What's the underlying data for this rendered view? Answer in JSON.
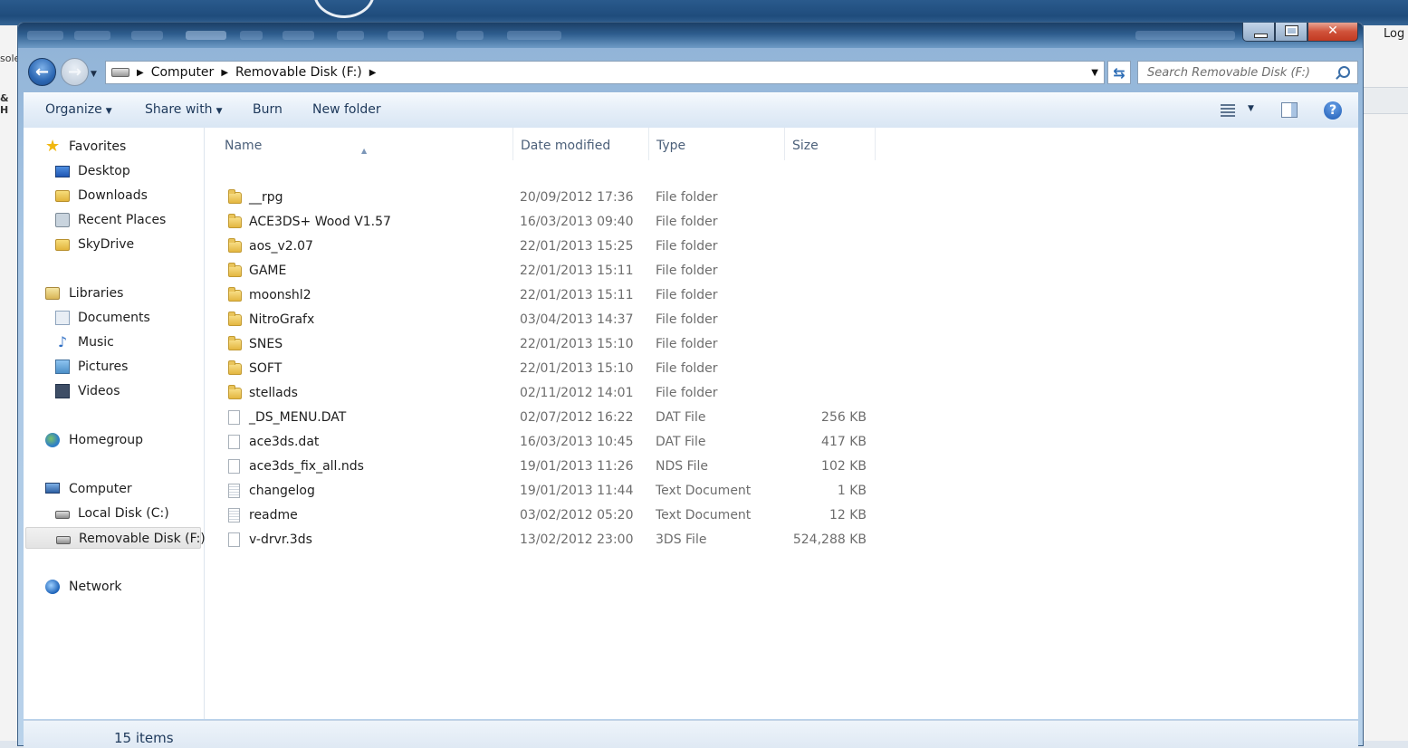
{
  "background": {
    "log_label": "Log",
    "left_fragment_1": "sole",
    "left_fragment_2": "& H"
  },
  "window": {
    "controls": {
      "minimize": "minimize",
      "maximize": "maximize",
      "close": "✕"
    }
  },
  "address_bar": {
    "crumbs": [
      "Computer",
      "Removable Disk (F:)"
    ],
    "search_placeholder": "Search Removable Disk (F:)"
  },
  "toolbar": {
    "organize": "Organize",
    "share_with": "Share with",
    "burn": "Burn",
    "new_folder": "New folder"
  },
  "nav_pane": {
    "favorites": {
      "label": "Favorites",
      "items": [
        "Desktop",
        "Downloads",
        "Recent Places",
        "SkyDrive"
      ]
    },
    "libraries": {
      "label": "Libraries",
      "items": [
        "Documents",
        "Music",
        "Pictures",
        "Videos"
      ]
    },
    "homegroup": "Homegroup",
    "computer": {
      "label": "Computer",
      "items": [
        "Local Disk (C:)",
        "Removable Disk (F:)"
      ]
    },
    "network": "Network"
  },
  "columns": {
    "name": "Name",
    "date": "Date modified",
    "type": "Type",
    "size": "Size"
  },
  "files": [
    {
      "name": "__rpg",
      "date": "20/09/2012 17:36",
      "type": "File folder",
      "size": "",
      "icon": "folder-icon"
    },
    {
      "name": "ACE3DS+ Wood V1.57",
      "date": "16/03/2013 09:40",
      "type": "File folder",
      "size": "",
      "icon": "folder-icon"
    },
    {
      "name": "aos_v2.07",
      "date": "22/01/2013 15:25",
      "type": "File folder",
      "size": "",
      "icon": "folder-icon"
    },
    {
      "name": "GAME",
      "date": "22/01/2013 15:11",
      "type": "File folder",
      "size": "",
      "icon": "folder-icon"
    },
    {
      "name": "moonshl2",
      "date": "22/01/2013 15:11",
      "type": "File folder",
      "size": "",
      "icon": "folder-icon"
    },
    {
      "name": "NitroGrafx",
      "date": "03/04/2013 14:37",
      "type": "File folder",
      "size": "",
      "icon": "folder-icon"
    },
    {
      "name": "SNES",
      "date": "22/01/2013 15:10",
      "type": "File folder",
      "size": "",
      "icon": "folder-icon"
    },
    {
      "name": "SOFT",
      "date": "22/01/2013 15:10",
      "type": "File folder",
      "size": "",
      "icon": "folder-icon"
    },
    {
      "name": "stellads",
      "date": "02/11/2012 14:01",
      "type": "File folder",
      "size": "",
      "icon": "folder-icon"
    },
    {
      "name": "_DS_MENU.DAT",
      "date": "02/07/2012 16:22",
      "type": "DAT File",
      "size": "256 KB",
      "icon": "file-icon"
    },
    {
      "name": "ace3ds.dat",
      "date": "16/03/2013 10:45",
      "type": "DAT File",
      "size": "417 KB",
      "icon": "file-icon"
    },
    {
      "name": "ace3ds_fix_all.nds",
      "date": "19/01/2013 11:26",
      "type": "NDS File",
      "size": "102 KB",
      "icon": "file-icon"
    },
    {
      "name": "changelog",
      "date": "19/01/2013 11:44",
      "type": "Text Document",
      "size": "1 KB",
      "icon": "text-file-icon"
    },
    {
      "name": "readme",
      "date": "03/02/2012 05:20",
      "type": "Text Document",
      "size": "12 KB",
      "icon": "text-file-icon"
    },
    {
      "name": "v-drvr.3ds",
      "date": "13/02/2012 23:00",
      "type": "3DS File",
      "size": "524,288 KB",
      "icon": "file-icon"
    }
  ],
  "status_bar": {
    "item_count": "15 items"
  }
}
